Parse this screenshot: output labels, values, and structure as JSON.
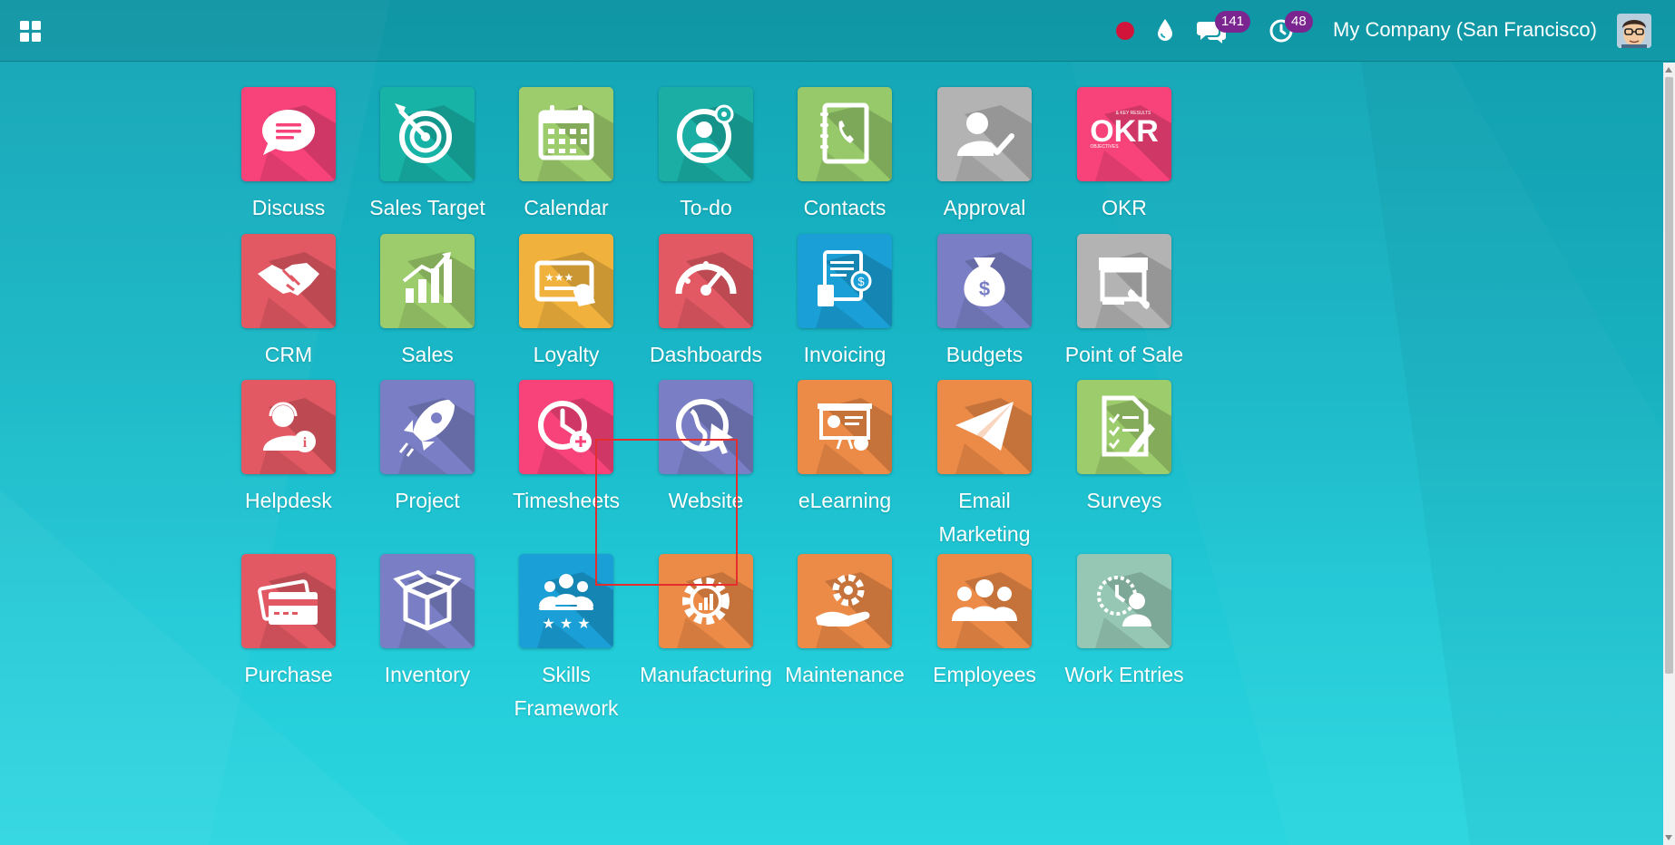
{
  "navbar": {
    "apps_menu_icon": "grid-icon",
    "status_dot_color": "#d1153a",
    "icons": {
      "status": "recording-dot-icon",
      "theme": "drop-icon",
      "messages": "chat-icon",
      "activities": "clock-icon"
    },
    "messages_count": "141",
    "activities_count": "48",
    "company": "My Company (San Francisco)",
    "badge_color": "#7b2590"
  },
  "apps": [
    {
      "label": "Discuss",
      "icon": "chat-bubble-icon",
      "color": "#f7427a"
    },
    {
      "label": "Sales Target",
      "icon": "target-icon",
      "color": "#17b3a7"
    },
    {
      "label": "Calendar",
      "icon": "calendar-icon",
      "color": "#9ccc6b"
    },
    {
      "label": "To-do",
      "icon": "todo-user-gear-icon",
      "color": "#1aaea5"
    },
    {
      "label": "Contacts",
      "icon": "address-book-icon",
      "color": "#97c96a"
    },
    {
      "label": "Approval",
      "icon": "user-check-icon",
      "color": "#b3b3b3"
    },
    {
      "label": "OKR",
      "icon": "okr-logo-icon",
      "color": "#f7427a"
    },
    {
      "label": "CRM",
      "icon": "handshake-icon",
      "color": "#e25963"
    },
    {
      "label": "Sales",
      "icon": "bar-chart-icon",
      "color": "#9ccc6b"
    },
    {
      "label": "Loyalty",
      "icon": "loyalty-card-icon",
      "color": "#f1b23d"
    },
    {
      "label": "Dashboards",
      "icon": "speedometer-icon",
      "color": "#e25963"
    },
    {
      "label": "Invoicing",
      "icon": "invoice-icon",
      "color": "#1a9fd6"
    },
    {
      "label": "Budgets",
      "icon": "money-bag-icon",
      "color": "#7a7fc5"
    },
    {
      "label": "Point of Sale",
      "icon": "shop-icon",
      "color": "#b3b3b3"
    },
    {
      "label": "Helpdesk",
      "icon": "support-agent-icon",
      "color": "#e25963"
    },
    {
      "label": "Project",
      "icon": "rocket-icon",
      "color": "#7a7fc5"
    },
    {
      "label": "Timesheets",
      "icon": "timesheet-clock-icon",
      "color": "#f7427a"
    },
    {
      "label": "Website",
      "icon": "globe-cursor-icon",
      "color": "#7a7fc5"
    },
    {
      "label": "eLearning",
      "icon": "presentation-icon",
      "color": "#ec8a47"
    },
    {
      "label": "Email\nMarketing",
      "icon": "paper-plane-icon",
      "color": "#ec8a47"
    },
    {
      "label": "Surveys",
      "icon": "survey-icon",
      "color": "#9ccc6b"
    },
    {
      "label": "Purchase",
      "icon": "credit-card-icon",
      "color": "#e25963"
    },
    {
      "label": "Inventory",
      "icon": "box-icon",
      "color": "#7a7fc5"
    },
    {
      "label": "Skills\nFramework",
      "icon": "team-stars-icon",
      "color": "#1a9fd6"
    },
    {
      "label": "Manufacturing",
      "icon": "gear-chart-icon",
      "color": "#ec8a47"
    },
    {
      "label": "Maintenance",
      "icon": "hand-gear-icon",
      "color": "#ec8a47"
    },
    {
      "label": "Employees",
      "icon": "people-icon",
      "color": "#ec8a47"
    },
    {
      "label": "Work Entries",
      "icon": "clock-user-icon",
      "color": "#96c7b4"
    }
  ],
  "selected_app": "Timesheets"
}
